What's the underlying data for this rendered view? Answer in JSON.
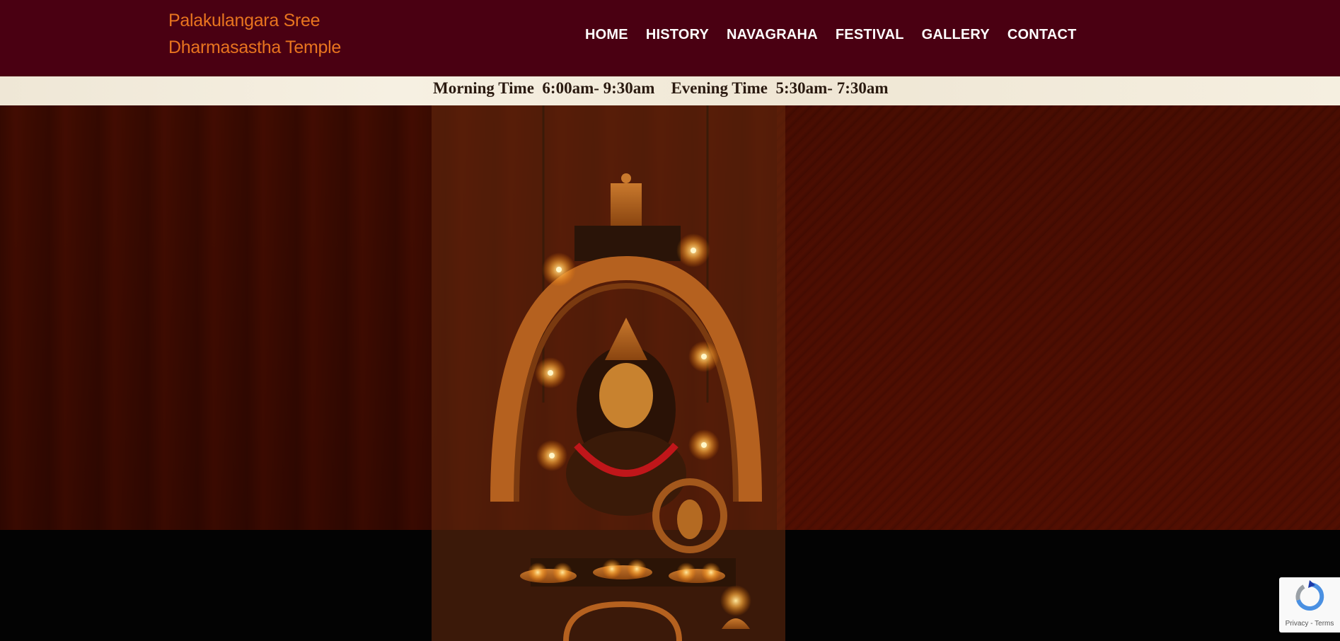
{
  "site": {
    "logo_line1": "Palakulangara Sree",
    "logo_line2": "Dharmasastha Temple"
  },
  "nav": {
    "items": [
      {
        "label": "HOME"
      },
      {
        "label": "HISTORY"
      },
      {
        "label": "NAVAGRAHA"
      },
      {
        "label": "FESTIVAL"
      },
      {
        "label": "GALLERY"
      },
      {
        "label": "CONTACT"
      }
    ]
  },
  "timings": {
    "text": "Morning Time  6:00am- 9:30am    Evening Time  5:30am- 7:30am"
  },
  "recaptcha": {
    "links": "Privacy - Terms"
  },
  "colors": {
    "header_bg": "#4a0012",
    "logo": "#e8741f",
    "nav_text": "#ffffff"
  }
}
